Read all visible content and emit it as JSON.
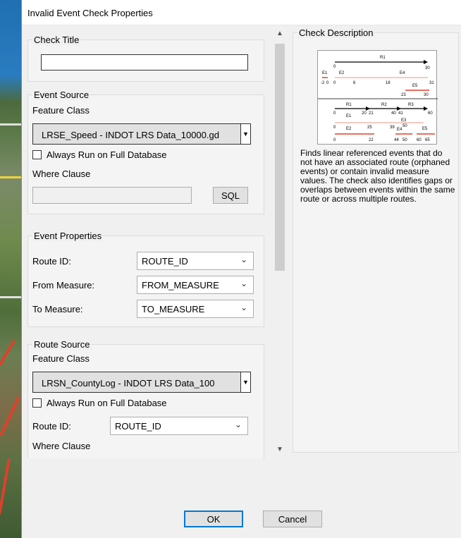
{
  "dialog": {
    "title": "Invalid Event Check Properties"
  },
  "check_title": {
    "legend": "Check Title",
    "value": ""
  },
  "event_source": {
    "legend": "Event Source",
    "feature_class_label": "Feature Class",
    "feature_class_value": "LRSE_Speed -  INDOT LRS Data_10000.gd",
    "always_run_label": "Always Run on Full Database",
    "always_run_checked": false,
    "where_clause_label": "Where Clause",
    "where_clause_value": "",
    "sql_button": "SQL"
  },
  "event_properties": {
    "legend": "Event Properties",
    "route_id_label": "Route ID:",
    "route_id_value": "ROUTE_ID",
    "from_measure_label": "From Measure:",
    "from_measure_value": "FROM_MEASURE",
    "to_measure_label": "To Measure:",
    "to_measure_value": "TO_MEASURE"
  },
  "route_source": {
    "legend": "Route Source",
    "feature_class_label": "Feature Class",
    "feature_class_value": "LRSN_CountyLog -  INDOT LRS Data_100",
    "always_run_label": "Always Run on Full Database",
    "always_run_checked": false,
    "route_id_label": "Route ID:",
    "route_id_value": "ROUTE_ID",
    "where_clause_label": "Where Clause"
  },
  "check_description": {
    "legend": "Check Description",
    "text": "Finds linear referenced events that do not have an associated route (orphaned events) or contain invalid measure values. The check also identifies gaps or overlaps between events within the same route or across multiple routes.",
    "diagram_labels": {
      "r1": "R1",
      "e1": "E1",
      "e2": "E2",
      "e3": "E3",
      "e4": "E4",
      "e5": "E5",
      "r2": "R2",
      "r3": "R3",
      "top_ticks": [
        "-2",
        "0",
        "0",
        "6",
        "16",
        "23",
        "30",
        "31"
      ],
      "top_zero": "0",
      "top_thirty": "30",
      "bottom_ticks": [
        "0",
        "20",
        "21",
        "40",
        "41",
        "60"
      ],
      "bottom_ticks2": [
        "0",
        "25",
        "39",
        "50",
        "22",
        "44",
        "50",
        "60",
        "65"
      ]
    }
  },
  "footer": {
    "ok": "OK",
    "cancel": "Cancel"
  },
  "colors": {
    "accent": "#0078d7",
    "event_red": "#e0402a"
  },
  "icons": {
    "scroll_up": "▲",
    "scroll_down": "▼",
    "chevron": "⌄"
  }
}
